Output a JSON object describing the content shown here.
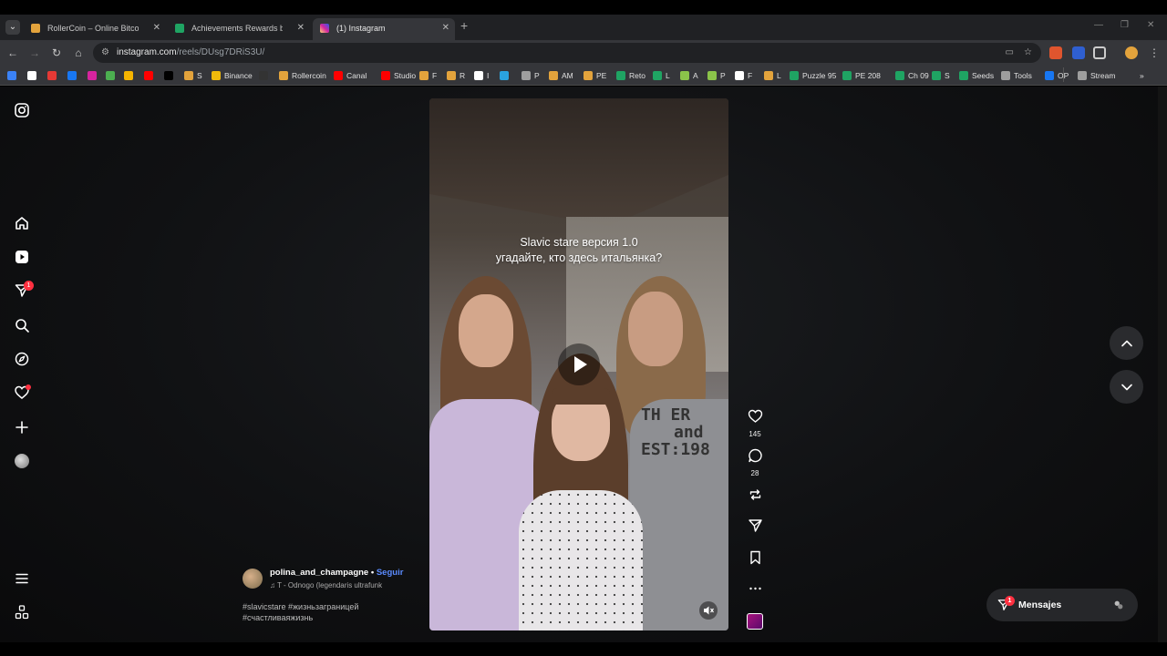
{
  "browser": {
    "tabs": [
      {
        "title": "RollerCoin – Online Bitcoin Mi",
        "close": "✕",
        "color": "#e3a33c"
      },
      {
        "title": "Achievements Rewards by Pien",
        "close": "✕",
        "color": "#1fa463"
      },
      {
        "title": "(1) Instagram",
        "close": "✕",
        "color": "#d6249f"
      }
    ],
    "new_tab": "+",
    "url_host": "instagram.com",
    "url_path": "/reels/DUsg7DRiS3U/",
    "bookmarks": [
      {
        "label": "",
        "color": "#3b82f6"
      },
      {
        "label": "",
        "color": "#ffffff"
      },
      {
        "label": "",
        "color": "#e53935"
      },
      {
        "label": "",
        "color": "#1877f2"
      },
      {
        "label": "",
        "color": "#d6249f"
      },
      {
        "label": "",
        "color": "#4caf50"
      },
      {
        "label": "",
        "color": "#f5b400"
      },
      {
        "label": "",
        "color": "#ff0000"
      },
      {
        "label": "",
        "color": "#000000"
      },
      {
        "label": "S",
        "color": "#e3a33c"
      },
      {
        "label": "Binance",
        "color": "#f0b90b"
      },
      {
        "label": "",
        "color": "#333333"
      },
      {
        "label": "Rollercoin",
        "color": "#e3a33c"
      },
      {
        "label": "Canal",
        "color": "#ff0000"
      },
      {
        "label": "Studio",
        "color": "#ff0000"
      },
      {
        "label": "F",
        "color": "#e3a33c"
      },
      {
        "label": "R",
        "color": "#e3a33c"
      },
      {
        "label": "I",
        "color": "#ffffff"
      },
      {
        "label": "",
        "color": "#2aa3e0"
      },
      {
        "label": "P",
        "color": "#9e9e9e"
      },
      {
        "label": "AM",
        "color": "#e3a33c"
      },
      {
        "label": "PE",
        "color": "#e3a33c"
      },
      {
        "label": "Reto",
        "color": "#1fa463"
      },
      {
        "label": "L",
        "color": "#1fa463"
      },
      {
        "label": "A",
        "color": "#8bc34a"
      },
      {
        "label": "P",
        "color": "#8bc34a"
      },
      {
        "label": "F",
        "color": "#ffffff"
      },
      {
        "label": "L",
        "color": "#e3a33c"
      },
      {
        "label": "Puzzle 95",
        "color": "#1fa463"
      },
      {
        "label": "PE 208",
        "color": "#1fa463"
      },
      {
        "label": "Ch 09",
        "color": "#1fa463"
      },
      {
        "label": "S",
        "color": "#1fa463"
      },
      {
        "label": "Seeds",
        "color": "#1fa463"
      },
      {
        "label": "Tools",
        "color": "#9e9e9e"
      },
      {
        "label": "OP",
        "color": "#1877f2"
      },
      {
        "label": "Stream",
        "color": "#9e9e9e"
      }
    ],
    "more_bookmarks": "»"
  },
  "sidebar": {
    "items": [
      {
        "icon": "instagram-logo-icon"
      },
      {
        "icon": "home-icon"
      },
      {
        "icon": "reels-icon"
      },
      {
        "icon": "direct-icon",
        "badge": "1"
      },
      {
        "icon": "search-icon"
      },
      {
        "icon": "explore-icon"
      },
      {
        "icon": "notifications-icon"
      },
      {
        "icon": "create-icon"
      },
      {
        "icon": "profile-icon"
      },
      {
        "icon": "menu-icon"
      },
      {
        "icon": "also-from-meta-icon"
      }
    ]
  },
  "reel": {
    "caption_line1": "Slavic stare версия 1.0",
    "caption_line2": "угадайте, кто здесь итальянка?",
    "shirt_text1": "TH   ER",
    "shirt_text2": "and",
    "shirt_text3": "EST:198",
    "username": "polina_and_champagne",
    "separator": " • ",
    "follow_label": "Seguir",
    "audio": "T - Odnogo (legendaris ultrafunk",
    "hashtags_line1": "#slavicstare #жизньзаграницей",
    "hashtags_line2": "#счастливаяжизнь"
  },
  "actions": {
    "likes": "145",
    "comments": "28"
  },
  "messages": {
    "label": "Mensajes",
    "badge": "1"
  },
  "colors": {
    "accent_blue": "#5b8bff",
    "badge_red": "#ff3040"
  }
}
